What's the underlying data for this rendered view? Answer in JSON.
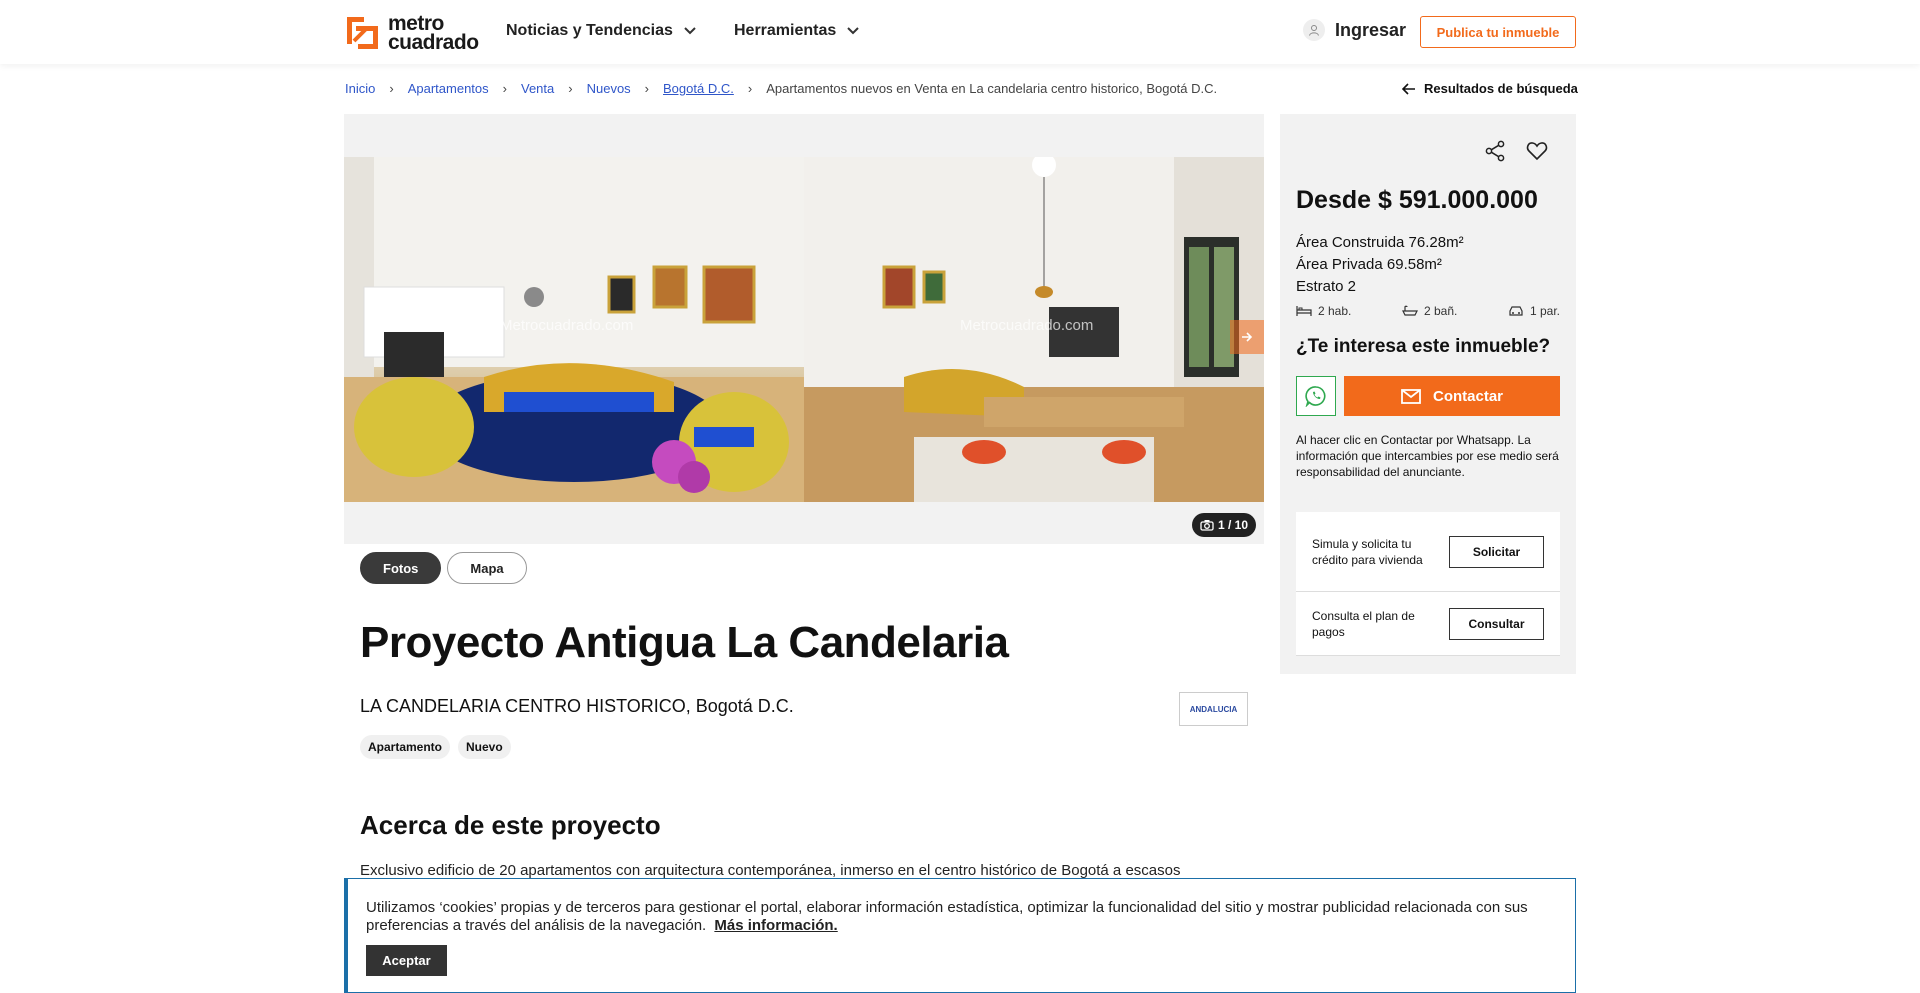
{
  "header": {
    "logo_line1": "metro",
    "logo_line2": "cuadrado",
    "nav": [
      {
        "label": "Noticias y Tendencias"
      },
      {
        "label": "Herramientas"
      }
    ],
    "login_label": "Ingresar",
    "publish_label": "Publica tu inmueble",
    "accent": "#f26a1b"
  },
  "breadcrumb": {
    "items": [
      "Inicio",
      "Apartamentos",
      "Venta",
      "Nuevos",
      "Bogotá D.C."
    ],
    "current": "Apartamentos nuevos en Venta en La candelaria centro historico, Bogotá D.C.",
    "back_label": "Resultados de búsqueda"
  },
  "gallery": {
    "watermark": "Metrocuadrado.com",
    "counter_current": "1",
    "counter_total": "10",
    "counter_label": "1 / 10",
    "tabs": [
      "Fotos",
      "Mapa"
    ]
  },
  "listing": {
    "title": "Proyecto Antigua La Candelaria",
    "location": "LA CANDELARIA CENTRO HISTORICO, Bogotá D.C.",
    "builder_logo": "ANDALUCIA",
    "tags": [
      "Apartamento",
      "Nuevo"
    ],
    "about_title": "Acerca de este proyecto",
    "about_text": "Exclusivo edificio de 20 apartamentos con arquitectura contemporánea, inmerso en el centro histórico de Bogotá a escasos"
  },
  "sidebar": {
    "price": "Desde $ 591.000.000",
    "features": [
      "Área Construida 76.28m²",
      "Área Privada 69.58m²",
      "Estrato 2"
    ],
    "amenities": [
      {
        "icon": "bed-icon",
        "label": "2 hab."
      },
      {
        "icon": "bathtub-icon",
        "label": "2 bañ."
      },
      {
        "icon": "car-icon",
        "label": "1 par."
      }
    ],
    "interest_title": "¿Te interesa este inmueble?",
    "contact_label": "Contactar",
    "disclaimer": "Al hacer clic en Contactar por Whatsapp. La información que intercambies por ese medio será responsabilidad del anunciante.",
    "credit_rows": [
      {
        "label": "Simula y solicita tu crédito para vivienda",
        "button": "Solicitar"
      },
      {
        "label": "Consulta el plan de pagos",
        "button": "Consultar"
      }
    ]
  },
  "cookie": {
    "text": "Utilizamos ‘cookies’ propias y de terceros para gestionar el portal, elaborar información estadística, optimizar la funcionalidad del sitio y mostrar publicidad relacionada con sus preferencias a través del análisis de la navegación.",
    "more_label": "Más información.",
    "accept_label": "Aceptar"
  }
}
